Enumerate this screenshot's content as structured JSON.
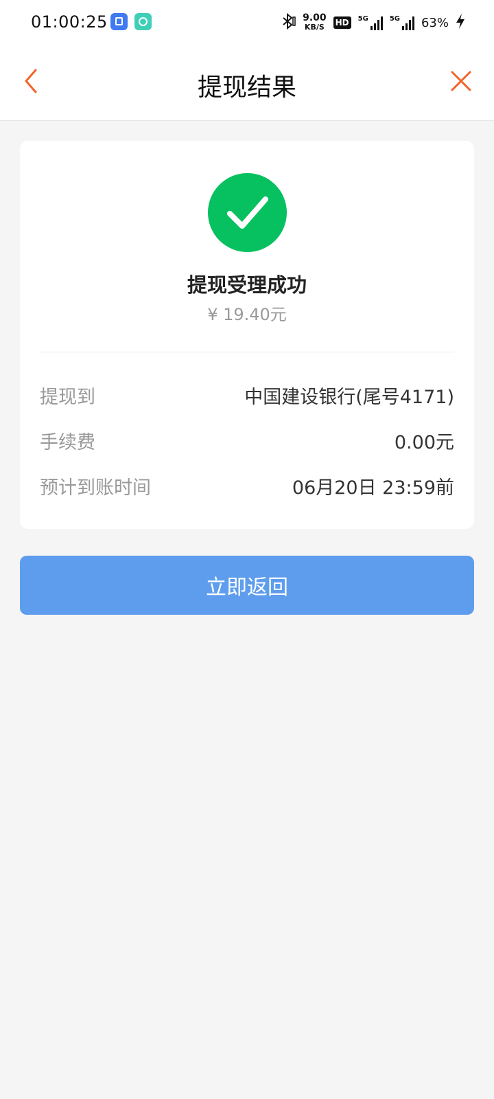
{
  "status_bar": {
    "time": "01:00:25",
    "net_speed_value": "9.00",
    "net_speed_unit": "KB/S",
    "hd_label": "HD",
    "signal_1_label": "5G",
    "signal_2_label": "5G",
    "battery_percent": "63%"
  },
  "header": {
    "title": "提现结果"
  },
  "result": {
    "status_text": "提现受理成功",
    "amount_text": "¥ 19.40元"
  },
  "details": [
    {
      "label": "提现到",
      "value": "中国建设银行(尾号4171)"
    },
    {
      "label": "手续费",
      "value": "0.00元"
    },
    {
      "label": "预计到账时间",
      "value": "06月20日 23:59前"
    }
  ],
  "actions": {
    "return_label": "立即返回"
  },
  "colors": {
    "accent_orange": "#f2642a",
    "success_green": "#07c160",
    "button_blue": "#5e9ded",
    "page_background": "#f5f5f5"
  }
}
